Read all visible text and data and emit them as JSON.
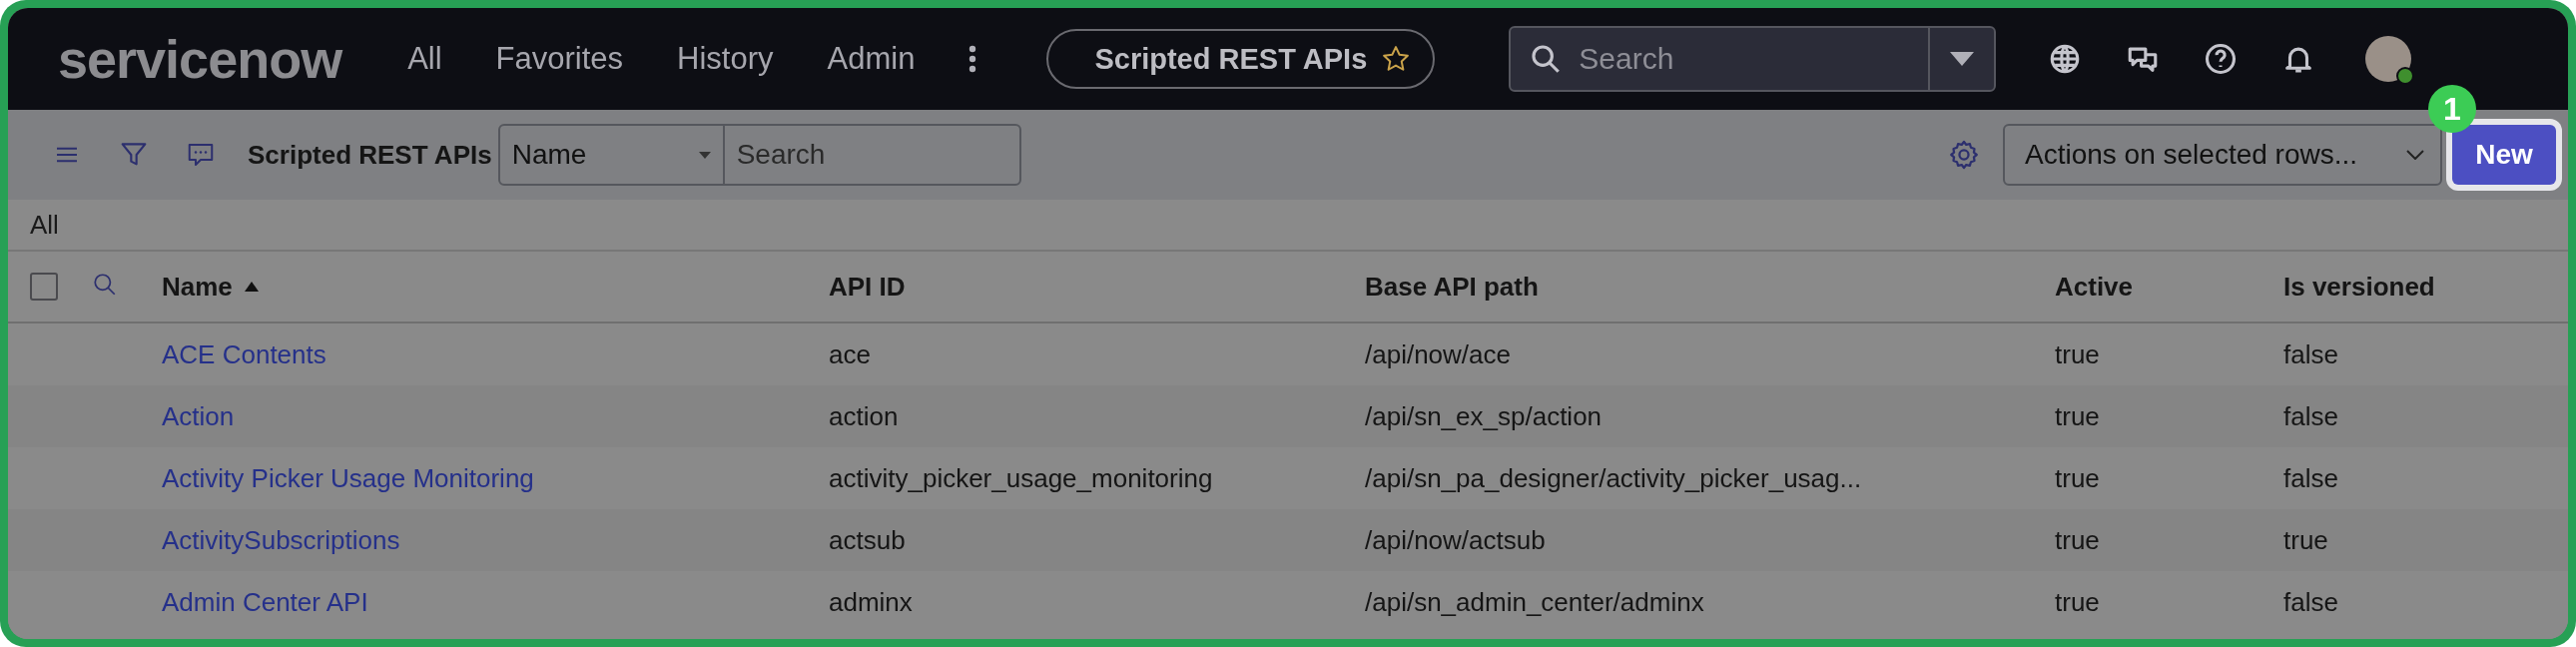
{
  "top_nav": {
    "logo": "servicenow",
    "menu": [
      {
        "label": "All"
      },
      {
        "label": "Favorites"
      },
      {
        "label": "History"
      },
      {
        "label": "Admin"
      }
    ],
    "current_page": {
      "title": "Scripted REST APIs",
      "favorited": false
    },
    "search": {
      "placeholder": "Search"
    }
  },
  "list_toolbar": {
    "title": "Scripted REST APIs",
    "field_select": "Name",
    "search": {
      "placeholder": "Search"
    },
    "actions_select": "Actions on selected rows...",
    "new_button": "New"
  },
  "callout": {
    "number": "1"
  },
  "breadcrumb": "All",
  "table": {
    "select_all": {
      "checked": false
    },
    "columns": [
      {
        "label": "Name",
        "sorted": true
      },
      {
        "label": "API ID",
        "sorted": false
      },
      {
        "label": "Base API path",
        "sorted": false
      },
      {
        "label": "Active",
        "sorted": false
      },
      {
        "label": "Is versioned",
        "sorted": false
      }
    ],
    "rows": [
      {
        "cells": [
          "ACE Contents",
          "ace",
          "/api/now/ace",
          "true",
          "false"
        ]
      },
      {
        "cells": [
          "Action",
          "action",
          "/api/sn_ex_sp/action",
          "true",
          "false"
        ]
      },
      {
        "cells": [
          "Activity Picker Usage Monitoring",
          "activity_picker_usage_monitoring",
          "/api/sn_pa_designer/activity_picker_usag...",
          "true",
          "false"
        ]
      },
      {
        "cells": [
          "ActivitySubscriptions",
          "actsub",
          "/api/now/actsub",
          "true",
          "true"
        ]
      },
      {
        "cells": [
          "Admin Center API",
          "adminx",
          "/api/sn_admin_center/adminx",
          "true",
          "false"
        ]
      }
    ]
  }
}
